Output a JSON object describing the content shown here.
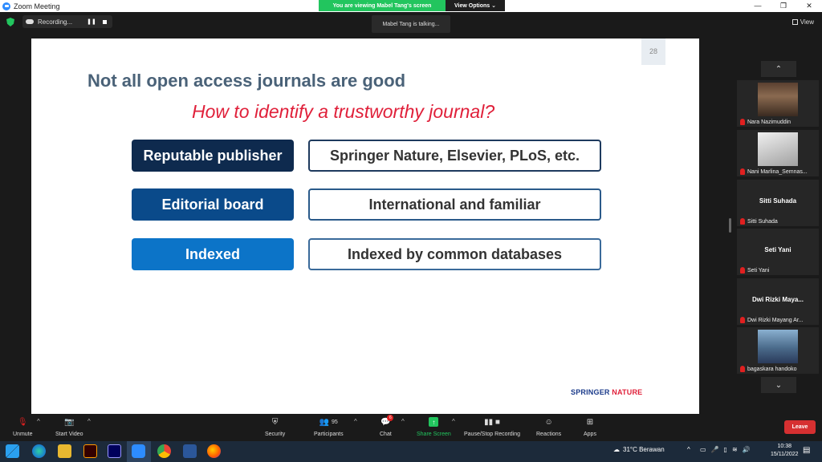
{
  "window": {
    "title": "Zoom Meeting",
    "controls": [
      "—",
      "❐",
      "✕"
    ]
  },
  "share_banner": {
    "viewing": "You are viewing Mabel Tang's screen",
    "view_options": "View Options ⌄"
  },
  "recording": {
    "label": "Recording...",
    "pause": "❚❚"
  },
  "talking": "Mabel Tang is talking...",
  "view_button": "View",
  "slide": {
    "page_number": "28",
    "title": "Not all open access journals are good",
    "subtitle": "How to identify a trustworthy journal?",
    "rows": [
      {
        "left": "Reputable publisher",
        "right": "Springer Nature, Elsevier, PLoS, etc."
      },
      {
        "left": "Editorial board",
        "right": "International and familiar"
      },
      {
        "left": "Indexed",
        "right": "Indexed by common databases"
      }
    ],
    "brand_springer": "SPRINGER",
    "brand_nature": " NATURE"
  },
  "participants_panel": {
    "up": "⌃",
    "down": "⌄",
    "tiles": [
      {
        "big": "",
        "label": "Nara Nazimuddin"
      },
      {
        "big": "",
        "label": "Nani Marlina_Semnas..."
      },
      {
        "big": "Sitti Suhada",
        "label": "Sitti Suhada"
      },
      {
        "big": "Seti Yani",
        "label": "Seti Yani"
      },
      {
        "big": "Dwi  Rizki  Maya...",
        "label": "Dwi Rizki Mayang Ar..."
      },
      {
        "big": "",
        "label": "bagaskara handoko"
      }
    ]
  },
  "toolbar": {
    "unmute": "Unmute",
    "start_video": "Start Video",
    "security": "Security",
    "participants": "Participants",
    "participants_count": "95",
    "chat": "Chat",
    "chat_badge": "6",
    "share_screen": "Share Screen",
    "pause_recording": "Pause/Stop Recording",
    "reactions": "Reactions",
    "apps": "Apps",
    "leave": "Leave",
    "caret": "^"
  },
  "taskbar": {
    "weather": "31°C  Berawan",
    "time": "10:38",
    "date": "15/11/2022",
    "tray_up": "^"
  },
  "colors": {
    "share_green": "#22c55e",
    "leave_red": "#d63031",
    "title_slate": "#4a6278",
    "subtitle_red": "#e0203a",
    "box_navy": "#0e2a4e",
    "box_blue": "#0a4a8a",
    "box_light_blue": "#0c74c8"
  }
}
